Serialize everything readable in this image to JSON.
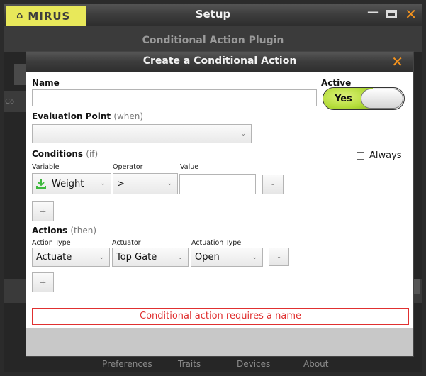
{
  "window": {
    "logo": "MIRUS",
    "title": "Setup"
  },
  "plugin": {
    "title": "Conditional Action Plugin"
  },
  "background": {
    "left_label": "Co"
  },
  "nav": {
    "preferences": "Preferences",
    "traits": "Traits",
    "devices": "Devices",
    "about": "About"
  },
  "dialog": {
    "title": "Create a Conditional Action",
    "name_label": "Name",
    "name_value": "",
    "active_label": "Active",
    "active_toggle": "Yes",
    "eval_label": "Evaluation Point",
    "eval_hint": "(when)",
    "eval_value": "",
    "conditions": {
      "label": "Conditions",
      "hint": "(if)",
      "always_label": "Always",
      "col_variable": "Variable",
      "col_operator": "Operator",
      "col_value": "Value",
      "variable": "Weight",
      "operator": ">",
      "value": "",
      "remove": "-",
      "add": "+"
    },
    "actions": {
      "label": "Actions",
      "hint": "(then)",
      "col_action_type": "Action Type",
      "col_actuator": "Actuator",
      "col_actuation_type": "Actuation Type",
      "action_type": "Actuate",
      "actuator": "Top Gate",
      "actuation_type": "Open",
      "remove": "-",
      "add": "+"
    },
    "error": "Conditional action requires a name"
  },
  "colors": {
    "accent_orange": "#f7941d",
    "logo_yellow": "#e8e85a",
    "toggle_green": "#b4dc3a",
    "error_red": "#e03030",
    "download_green": "#3db83d"
  }
}
